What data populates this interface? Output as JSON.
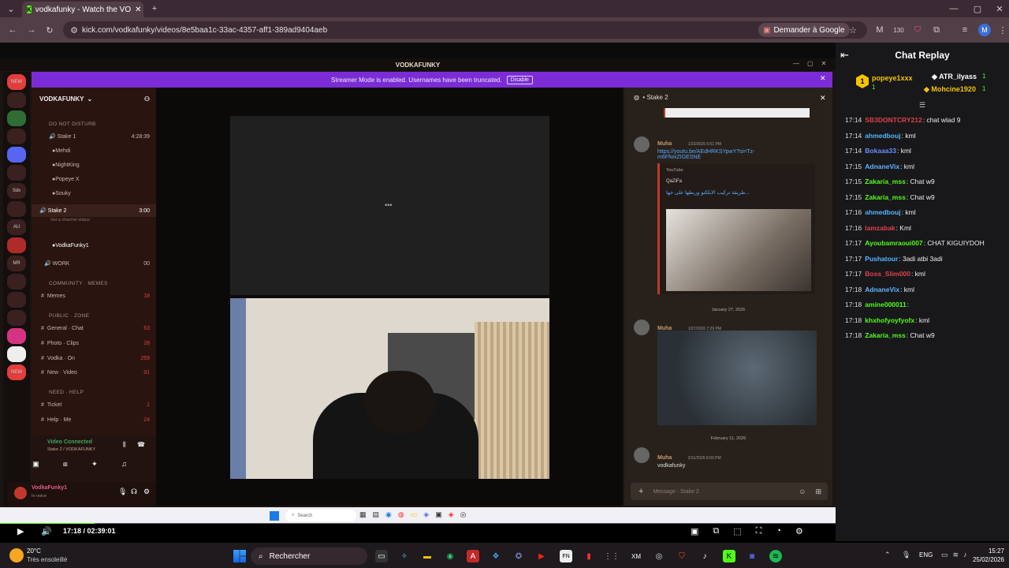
{
  "browser": {
    "tab_title": "vodkafunky - Watch the VO",
    "url": "kick.com/vodkafunky/videos/8e5baa1c-33ac-4357-aff1-389ad9404aeb",
    "google_button": "Demander à Google",
    "extension_badge": "130"
  },
  "discord": {
    "window_title": "VODKAFUNKY",
    "streamer_banner": "Streamer Mode is enabled. Usernames have been truncated.",
    "disable_label": "Disable",
    "server_name": "VODKAFUNKY",
    "categories": {
      "dnd": "DO NOT DISTURB",
      "community": "COMMUNITY · MEMES",
      "public": "PUBLIC · ZONE",
      "help": "NEED · HELP"
    },
    "channels": [
      {
        "name": "Stake 1",
        "meta": "4:28:39"
      },
      {
        "name": "Mehdi",
        "meta": ""
      },
      {
        "name": "NightKing",
        "meta": ""
      },
      {
        "name": "Popeye X",
        "meta": ""
      },
      {
        "name": "Souky",
        "meta": ""
      },
      {
        "name": "Stake 2",
        "meta": "3:00"
      },
      {
        "name": "Set a channel status",
        "meta": ""
      },
      {
        "name": "VodkaFunky1",
        "meta": ""
      },
      {
        "name": "WORK",
        "meta": "00"
      },
      {
        "name": "Memes",
        "meta": "18"
      },
      {
        "name": "General · Chat",
        "meta": "63"
      },
      {
        "name": "Photo · Clips",
        "meta": "28"
      },
      {
        "name": "Vodka · On",
        "meta": "269"
      },
      {
        "name": "New · Video",
        "meta": "91"
      },
      {
        "name": "Ticket",
        "meta": "1"
      },
      {
        "name": "Help · Me",
        "meta": "24"
      }
    ],
    "voice_status": "Video Connected",
    "voice_channel": "Stake 2 / VODKAFUNKY",
    "user_name": "VodkaFunky1",
    "user_status": "In voice",
    "chat_channel": "Stake 2",
    "messages": [
      {
        "author": "Muha",
        "time": "1/23/2026 6:51 PM",
        "text": "https://youtu.be/AEdHRKSYpwY?si=Tz-m6FfwxZIGESNE"
      },
      {
        "author": "",
        "time": "",
        "text": "YouTube"
      },
      {
        "author": "",
        "time": "",
        "text": "QaZiFa"
      },
      {
        "author": "",
        "time": "",
        "text": "طريقة تركيب الابلكتو وربطها على جها..."
      }
    ],
    "date_separator_1": "January 27, 2026",
    "message_2_author": "Muha",
    "message_2_time": "1/27/2026 7:29 PM",
    "date_separator_2": "February 11, 2026",
    "message_3_author": "Muha",
    "message_3_time": "2/11/2026 8:00 PM",
    "message_3_text": "vodkafunky",
    "message_placeholder": "Message · Stake 2",
    "search_placeholder": "Search"
  },
  "player": {
    "time": "17:18 / 02:39:01",
    "progress_fraction": 0.113
  },
  "chat_replay": {
    "title": "Chat Replay",
    "pinned": [
      {
        "name": "popeye1xxx",
        "count": "1"
      },
      {
        "name": "ATR_ilyass",
        "count": "1"
      },
      {
        "name": "Mohcine1920",
        "count": "1"
      }
    ],
    "lines": [
      {
        "time": "17:14",
        "name": "SB3DONTCRY212",
        "color": "#e0404a",
        "msg": "chat wlad 9"
      },
      {
        "time": "17:14",
        "name": "ahmedbouj",
        "color": "#53b7ff",
        "msg": "kml"
      },
      {
        "time": "17:14",
        "name": "Bokaaa33",
        "color": "#6a8dff",
        "msg": "kml"
      },
      {
        "time": "17:15",
        "name": "AdnaneVix",
        "color": "#66b3ff",
        "msg": "kml"
      },
      {
        "time": "17:15",
        "name": "Zakaria_mss",
        "color": "#53fc18",
        "msg": "Chat w9"
      },
      {
        "time": "17:15",
        "name": "Zakaria_mss",
        "color": "#53fc18",
        "msg": "Chat w9"
      },
      {
        "time": "17:16",
        "name": "ahmedbouj",
        "color": "#53b7ff",
        "msg": "kml"
      },
      {
        "time": "17:16",
        "name": "lamzabak",
        "color": "#e0404a",
        "msg": "Kml"
      },
      {
        "time": "17:17",
        "name": "Ayoubamraoui007",
        "color": "#53fc18",
        "msg": "CHAT KIGUIYDOH"
      },
      {
        "time": "17:17",
        "name": "Pushatour",
        "color": "#53b7ff",
        "msg": "3adi atbi 3adi"
      },
      {
        "time": "17:17",
        "name": "Boss_Slim000",
        "color": "#e0404a",
        "msg": "kml"
      },
      {
        "time": "17:18",
        "name": "AdnaneVix",
        "color": "#66b3ff",
        "msg": "kml"
      },
      {
        "time": "17:18",
        "name": "amine000011",
        "color": "#53fc18",
        "msg": ""
      },
      {
        "time": "17:18",
        "name": "khxhofyoyfyofx",
        "color": "#53fc18",
        "msg": "kml"
      },
      {
        "time": "17:18",
        "name": "Zakaria_mss",
        "color": "#53fc18",
        "msg": "Chat w9"
      }
    ]
  },
  "windows": {
    "weather_temp": "20°C",
    "weather_desc": "Très ensoleillé",
    "search_label": "Rechercher",
    "lang": "ENG",
    "clock_time": "15:27",
    "clock_date": "25/02/2026"
  }
}
